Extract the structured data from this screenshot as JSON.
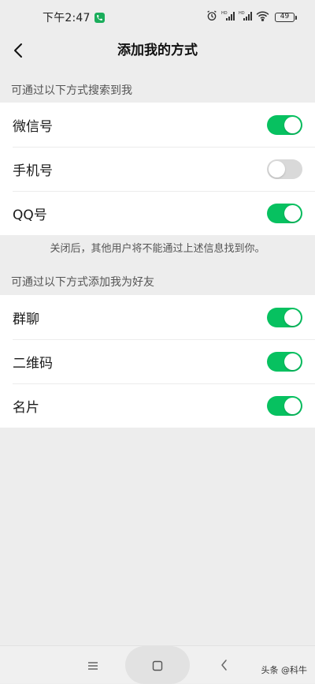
{
  "status_bar": {
    "time": "下午2:47",
    "battery": "49",
    "colors": {
      "call_badge": "#1aad5b"
    },
    "icons": [
      "phone-call-icon",
      "alarm-icon",
      "hd-signal-icon",
      "hd-signal-icon",
      "wifi-icon",
      "battery-icon"
    ]
  },
  "nav": {
    "title": "添加我的方式",
    "back_icon": "chevron-left-icon"
  },
  "search_section": {
    "header": "可通过以下方式搜索到我",
    "items": [
      {
        "label": "微信号",
        "enabled": true
      },
      {
        "label": "手机号",
        "enabled": false
      },
      {
        "label": "QQ号",
        "enabled": true
      }
    ],
    "hint": "关闭后，其他用户将不能通过上述信息找到你。"
  },
  "add_section": {
    "header": "可通过以下方式添加我为好友",
    "items": [
      {
        "label": "群聊",
        "enabled": true
      },
      {
        "label": "二维码",
        "enabled": true
      },
      {
        "label": "名片",
        "enabled": true
      }
    ]
  },
  "colors": {
    "toggle_on": "#07c160",
    "toggle_off": "#d9d9d9",
    "background": "#ededed"
  },
  "system_nav": {
    "icons": [
      "menu-icon",
      "home-icon",
      "back-icon"
    ]
  },
  "watermark": "头条 @科牛"
}
